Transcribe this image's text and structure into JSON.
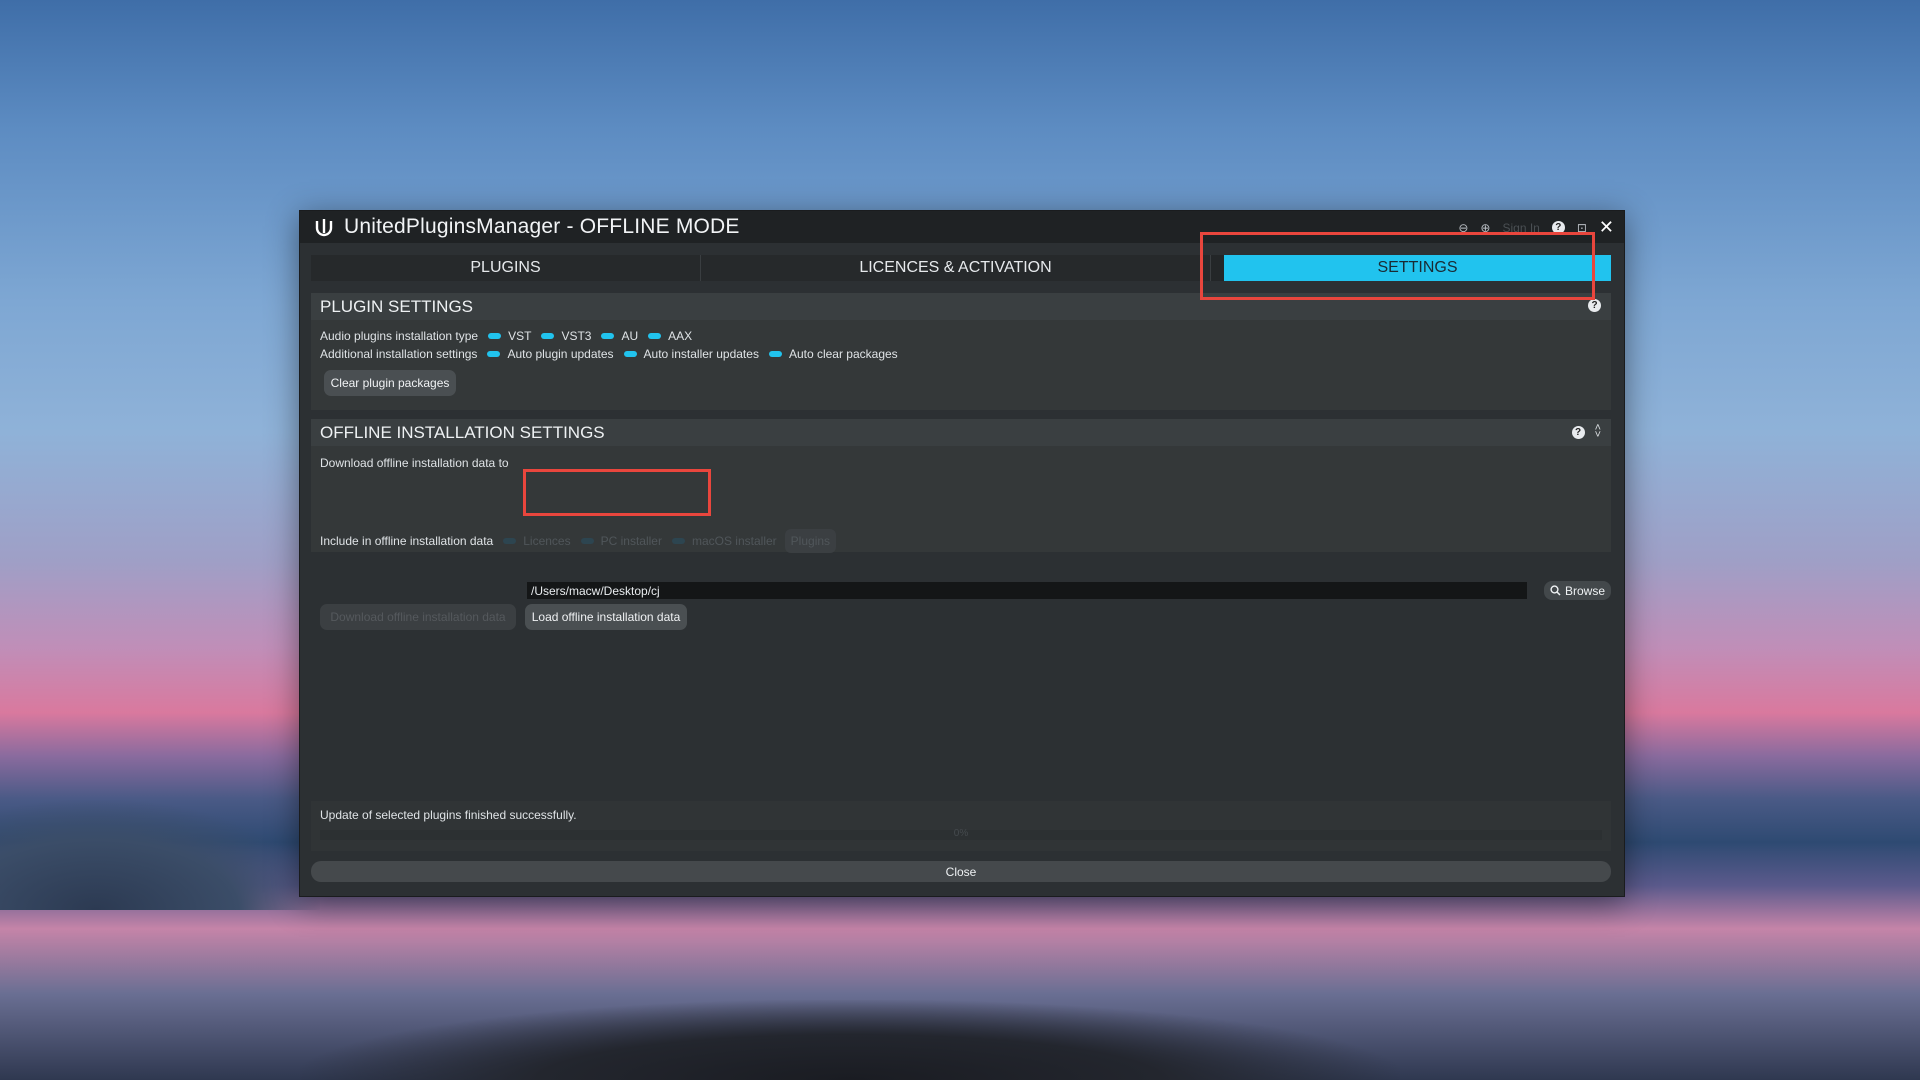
{
  "window": {
    "title": "UnitedPluginsManager - OFFLINE MODE",
    "sign_in": "Sign In",
    "help_symbol": "?",
    "close_symbol": "✕"
  },
  "tabs": [
    {
      "label": "PLUGINS"
    },
    {
      "label": "LICENCES & ACTIVATION"
    },
    {
      "label": "SETTINGS",
      "active": true
    }
  ],
  "plugin_settings": {
    "heading": "PLUGIN SETTINGS",
    "install_type_label": "Audio plugins installation type",
    "install_types": [
      "VST",
      "VST3",
      "AU",
      "AAX"
    ],
    "additional_label": "Additional installation settings",
    "additional_options": [
      "Auto plugin updates",
      "Auto installer updates",
      "Auto clear packages"
    ],
    "clear_button": "Clear plugin packages"
  },
  "offline_settings": {
    "heading": "OFFLINE INSTALLATION SETTINGS",
    "download_to_label": "Download offline installation data to",
    "path_value": "/Users/macw/Desktop/cj",
    "browse_label": "Browse",
    "download_button": "Download offline installation data",
    "load_button": "Load offline installation data",
    "include_label": "Include in offline installation data",
    "include_options": [
      "Licences",
      "PC installer",
      "macOS installer"
    ],
    "plugins_button": "Plugins"
  },
  "status": {
    "message": "Update of selected plugins finished successfully.",
    "progress_label": "0%",
    "progress": 0
  },
  "footer": {
    "close_label": "Close"
  },
  "colors": {
    "accent": "#21c3ee",
    "highlight": "#e9463d"
  }
}
